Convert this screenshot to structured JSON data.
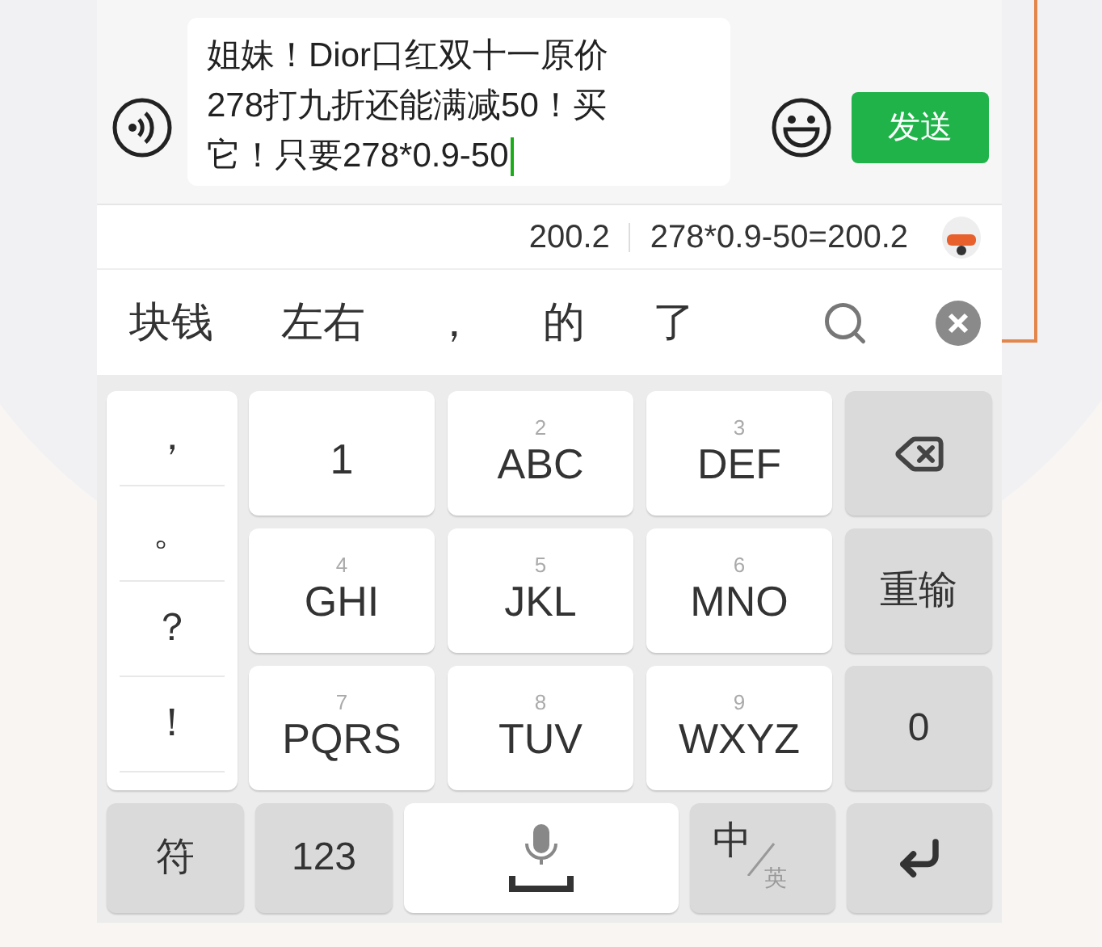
{
  "input": {
    "lines": [
      "姐妹！Dior口红双十一原价",
      "278打九折还能满减50！买",
      "它！只要278*0.9-50"
    ]
  },
  "send_button": "发送",
  "calc_bar": {
    "result": "200.2",
    "expression": "278*0.9-50=200.2"
  },
  "candidates": [
    "块钱",
    "左右",
    "，",
    "的",
    "了"
  ],
  "punctuation": [
    "，",
    "。",
    "？",
    "！"
  ],
  "keys": [
    {
      "kind": "digit",
      "label": "1"
    },
    {
      "kind": "letters",
      "hint": "2",
      "label": "ABC"
    },
    {
      "kind": "letters",
      "hint": "3",
      "label": "DEF"
    },
    {
      "kind": "backspace"
    },
    {
      "kind": "letters",
      "hint": "4",
      "label": "GHI"
    },
    {
      "kind": "letters",
      "hint": "5",
      "label": "JKL"
    },
    {
      "kind": "letters",
      "hint": "6",
      "label": "MNO"
    },
    {
      "kind": "function",
      "label": "重输"
    },
    {
      "kind": "letters",
      "hint": "7",
      "label": "PQRS"
    },
    {
      "kind": "letters",
      "hint": "8",
      "label": "TUV"
    },
    {
      "kind": "letters",
      "hint": "9",
      "label": "WXYZ"
    },
    {
      "kind": "function",
      "label": "0"
    }
  ],
  "bottom_row": [
    {
      "kind": "function",
      "label": "符"
    },
    {
      "kind": "function",
      "label": "123"
    },
    {
      "kind": "space"
    },
    {
      "kind": "language",
      "main": "中",
      "sub": "英"
    },
    {
      "kind": "enter"
    }
  ]
}
